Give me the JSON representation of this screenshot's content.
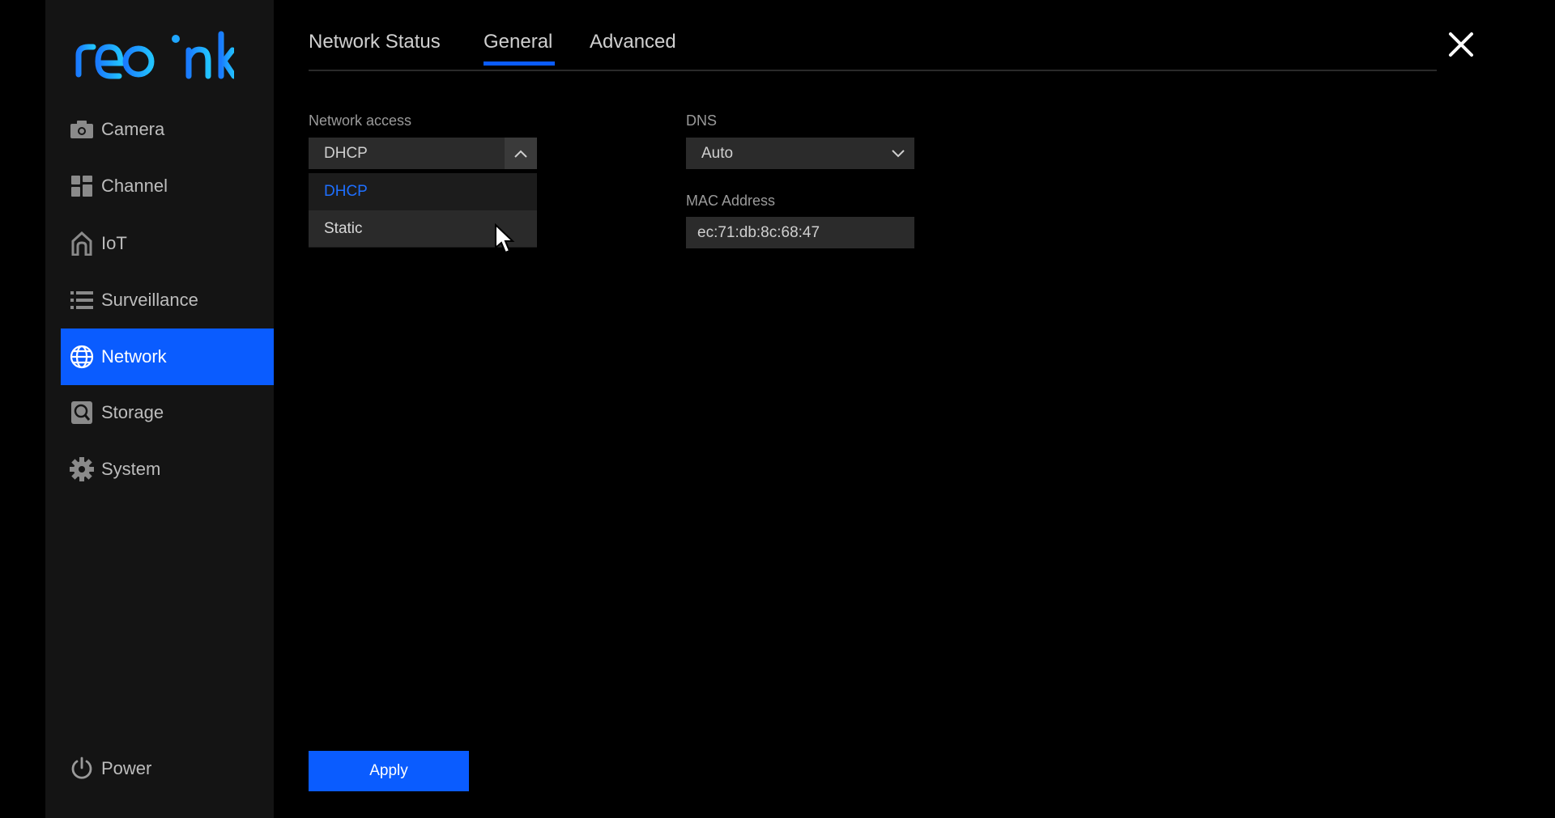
{
  "brand": {
    "logo_text": "reolink",
    "accent_color": "#0a5cff"
  },
  "sidebar": {
    "items": [
      {
        "label": "Camera",
        "icon": "camera-icon"
      },
      {
        "label": "Channel",
        "icon": "grid-icon"
      },
      {
        "label": "IoT",
        "icon": "home-icon"
      },
      {
        "label": "Surveillance",
        "icon": "list-icon"
      },
      {
        "label": "Network",
        "icon": "globe-icon",
        "active": true
      },
      {
        "label": "Storage",
        "icon": "storage-icon"
      },
      {
        "label": "System",
        "icon": "gear-icon"
      }
    ],
    "power": {
      "label": "Power",
      "icon": "power-icon"
    }
  },
  "tabs": [
    {
      "label": "Network Status"
    },
    {
      "label": "General",
      "active": true
    },
    {
      "label": "Advanced"
    }
  ],
  "form": {
    "network_access": {
      "label": "Network access",
      "value": "DHCP",
      "options": [
        "DHCP",
        "Static"
      ]
    },
    "dns": {
      "label": "DNS",
      "value": "Auto"
    },
    "mac": {
      "label": "MAC Address",
      "value": "ec:71:db:8c:68:47"
    }
  },
  "apply_label": "Apply"
}
